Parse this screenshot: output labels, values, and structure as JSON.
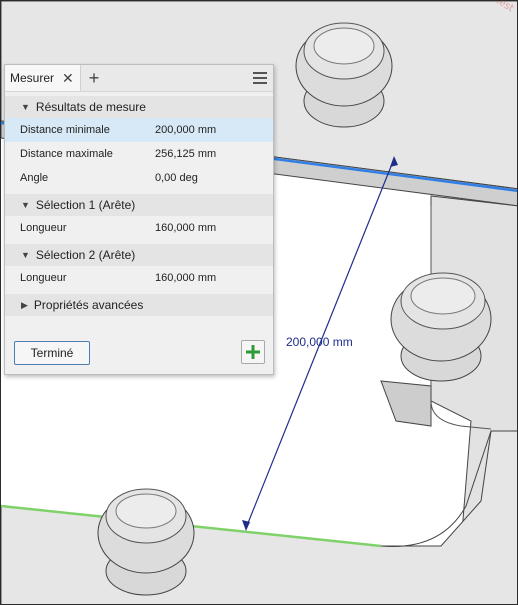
{
  "watermark": "d3d6c-d6cb-47 · 03ad701c6 test",
  "viewport": {
    "dimension_label": "200,000 mm",
    "colors": {
      "selection1_edge": "#2f7fe6",
      "selection2_edge": "#7fd26a",
      "dimension_line": "#1e2d8c",
      "part_face": "#e6e6e6"
    }
  },
  "panel": {
    "tab_label": "Mesurer",
    "close_icon": "close-icon",
    "add_tab_icon": "plus-icon",
    "menu_icon": "hamburger-menu-icon",
    "sections": [
      {
        "title": "Résultats de mesure",
        "expanded": true,
        "rows": [
          {
            "label": "Distance minimale",
            "value": "200,000 mm",
            "selected": true
          },
          {
            "label": "Distance maximale",
            "value": "256,125 mm",
            "selected": false
          },
          {
            "label": "Angle",
            "value": "0,00 deg",
            "selected": false
          }
        ]
      },
      {
        "title": "Sélection 1 (Arête)",
        "expanded": true,
        "rows": [
          {
            "label": "Longueur",
            "value": "160,000 mm",
            "selected": false
          }
        ]
      },
      {
        "title": "Sélection 2 (Arête)",
        "expanded": true,
        "rows": [
          {
            "label": "Longueur",
            "value": "160,000 mm",
            "selected": false
          }
        ]
      },
      {
        "title": "Propriétés avancées",
        "expanded": false,
        "rows": []
      }
    ],
    "done_label": "Terminé",
    "add_icon": "green-plus-icon",
    "accent": "#4f7fb0"
  }
}
